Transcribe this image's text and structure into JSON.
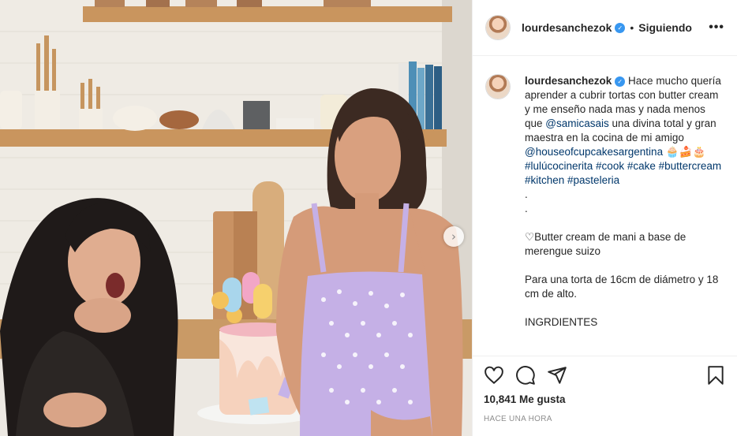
{
  "post": {
    "username": "lourdesanchezok",
    "verified_icon": "verified-badge-icon",
    "separator": "•",
    "follow_label": "Siguiendo",
    "more_label": "•••",
    "caption_user": "lourdesanchezok",
    "caption_lines": {
      "p1": "Hace mucho quería aprender a cubrir tortas con butter cream y me enseño nada mas y nada menos que ",
      "mention1": "@samicasais",
      "p2": " una divina total y gran maestra en la cocina de mi amigo",
      "mention2": "@houseofcupcakesargentina",
      "emojis": " 🧁🍰🎂",
      "hashtags": "#lulúcocinerita #cook #cake #buttercream #kitchen #pasteleria",
      "dots": ".\n.",
      "p3": "♡Butter cream de mani a base de merengue suizo",
      "p4": "Para una torta de 16cm de diámetro y 18 cm de alto.",
      "p5": "INGRDIENTES"
    },
    "likes": "10,841 Me gusta",
    "timestamp": "HACE UNA HORA"
  },
  "icons": {
    "like": "heart-icon",
    "comment": "comment-icon",
    "share": "share-icon",
    "save": "bookmark-icon",
    "next": "chevron-right-icon"
  },
  "colors": {
    "link": "#00376b",
    "verified": "#3897f0",
    "border": "#efefef",
    "muted": "#8e8e8e"
  }
}
